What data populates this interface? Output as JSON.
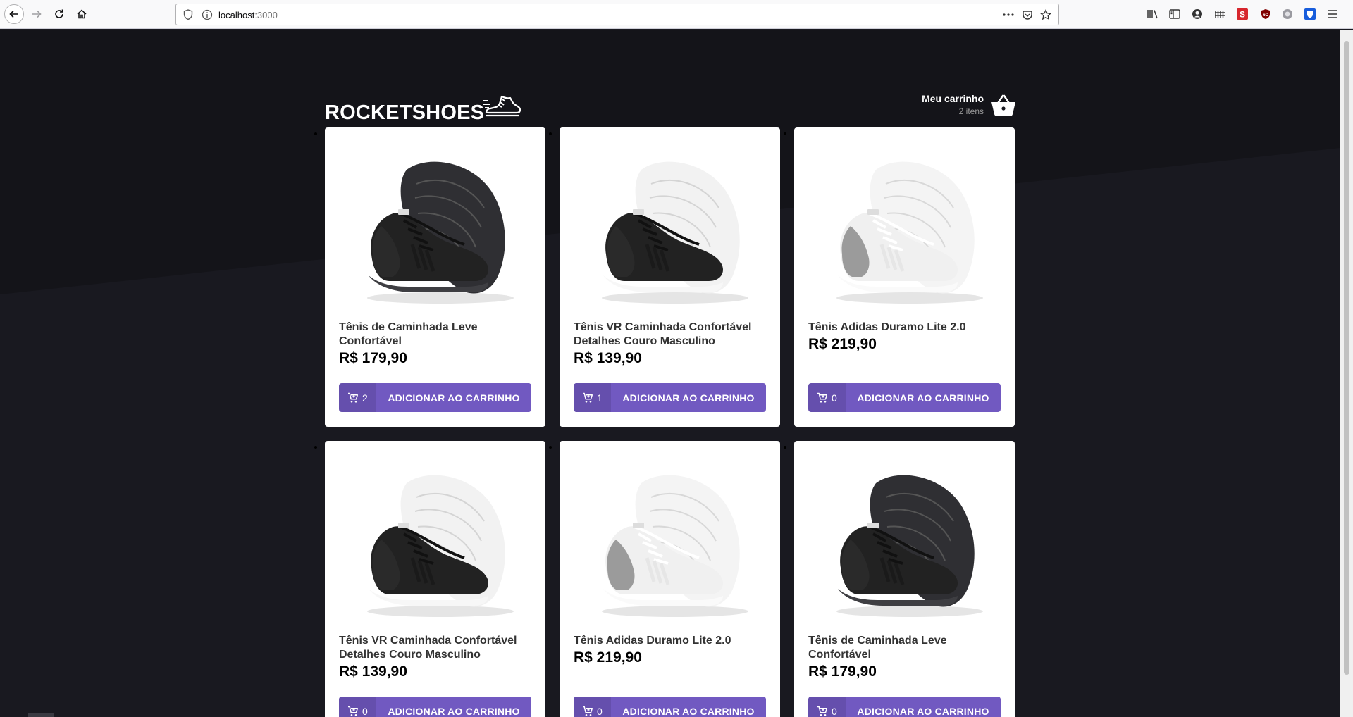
{
  "browser": {
    "url_host": "localhost",
    "url_port": ":3000"
  },
  "header": {
    "logo": "ROCKETSHOES",
    "cart_title": "Meu carrinho",
    "cart_count": "2 itens"
  },
  "products": [
    {
      "title": "Tênis de Caminhada Leve Confortável",
      "price": "R$ 179,90",
      "qty": "2",
      "button": "ADICIONAR AO CARRINHO",
      "variant": "black-black"
    },
    {
      "title": "Tênis VR Caminhada Confortável Detalhes Couro Masculino",
      "price": "R$ 139,90",
      "qty": "1",
      "button": "ADICIONAR AO CARRINHO",
      "variant": "black-white"
    },
    {
      "title": "Tênis Adidas Duramo Lite 2.0",
      "price": "R$ 219,90",
      "qty": "0",
      "button": "ADICIONAR AO CARRINHO",
      "variant": "white-grey"
    },
    {
      "title": "Tênis VR Caminhada Confortável Detalhes Couro Masculino",
      "price": "R$ 139,90",
      "qty": "0",
      "button": "ADICIONAR AO CARRINHO",
      "variant": "black-white"
    },
    {
      "title": "Tênis Adidas Duramo Lite 2.0",
      "price": "R$ 219,90",
      "qty": "0",
      "button": "ADICIONAR AO CARRINHO",
      "variant": "white-grey"
    },
    {
      "title": "Tênis de Caminhada Leve Confortável",
      "price": "R$ 179,90",
      "qty": "0",
      "button": "ADICIONAR AO CARRINHO",
      "variant": "black-black"
    }
  ],
  "colors": {
    "background": "#191920",
    "accent": "#7159c1",
    "card": "#ffffff"
  }
}
